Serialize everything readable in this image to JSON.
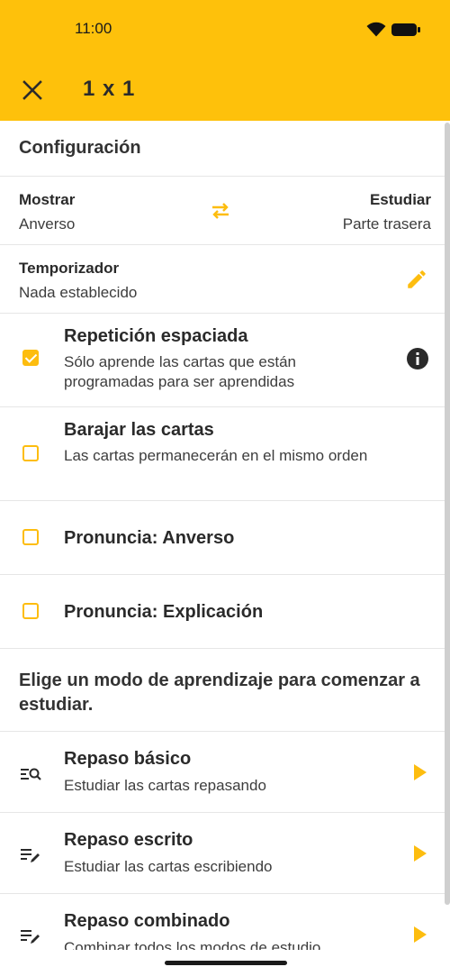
{
  "status_bar": {
    "time": "11:00"
  },
  "header": {
    "title": "1 x 1"
  },
  "configuration": {
    "heading": "Configuración",
    "show_label": "Mostrar",
    "show_value": "Anverso",
    "study_label": "Estudiar",
    "study_value": "Parte trasera",
    "timer_label": "Temporizador",
    "timer_value": "Nada establecido"
  },
  "options": [
    {
      "title": "Repetición espaciada",
      "desc": "Sólo aprende las cartas que están programadas para ser aprendidas",
      "checked": true
    },
    {
      "title": "Barajar las cartas",
      "desc": "Las cartas permanecerán en el mismo orden",
      "checked": false
    },
    {
      "title": "Pronuncia: Anverso",
      "checked": false
    },
    {
      "title": "Pronuncia: Explicación",
      "checked": false
    }
  ],
  "modes_heading": "Elige un modo de aprendizaje para comenzar a estudiar.",
  "modes": [
    {
      "title": "Repaso básico",
      "desc": "Estudiar las cartas repasando",
      "icon": "search-list-icon"
    },
    {
      "title": "Repaso escrito",
      "desc": "Estudiar las cartas escribiendo",
      "icon": "edit-list-icon"
    },
    {
      "title": "Repaso combinado",
      "desc": "Combinar todos los modos de estudio",
      "icon": "combined-list-icon"
    }
  ],
  "colors": {
    "accent": "#fec10b",
    "text": "#212121"
  }
}
